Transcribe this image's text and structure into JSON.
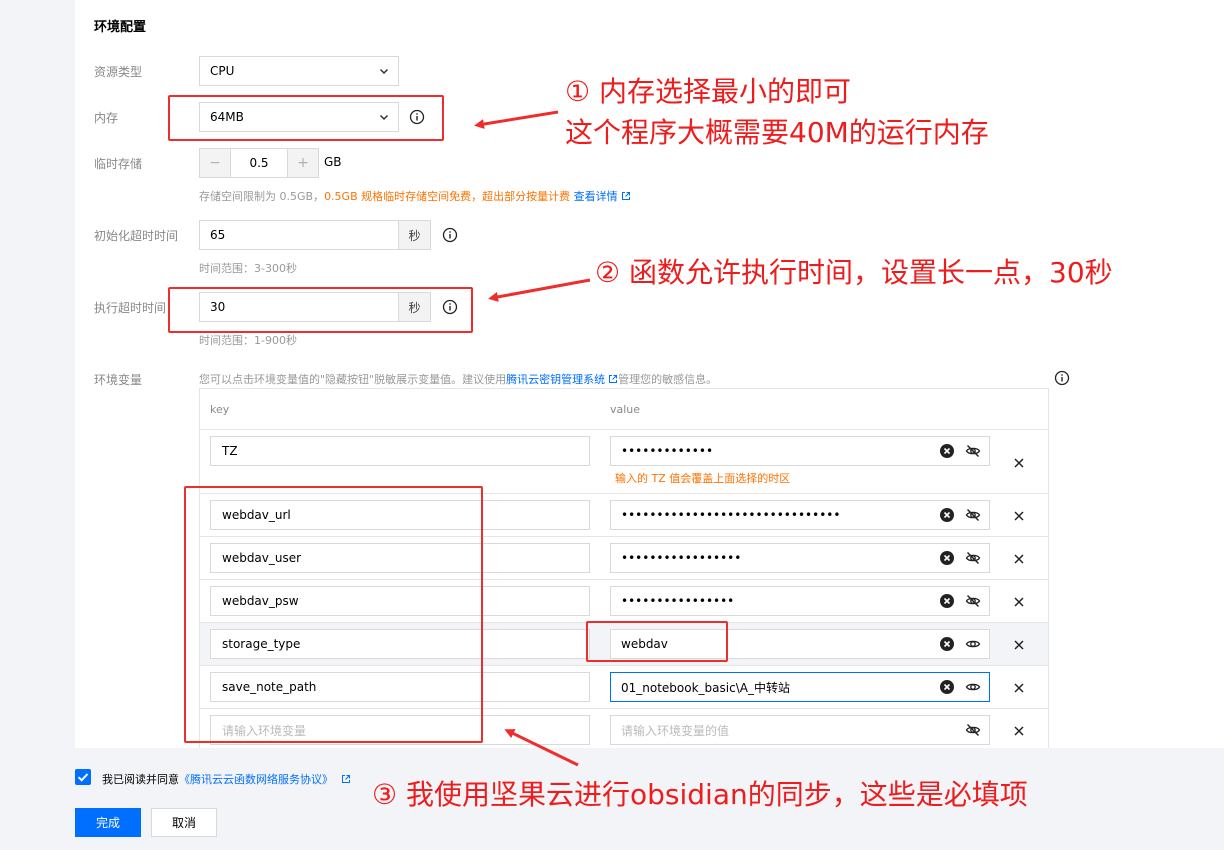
{
  "section_title": "环境配置",
  "resource": {
    "label": "资源类型",
    "value": "CPU"
  },
  "memory": {
    "label": "内存",
    "value": "64MB"
  },
  "temp_storage": {
    "label": "临时存储",
    "minus": "−",
    "value": "0.5",
    "plus": "+",
    "unit": "GB",
    "hint_prefix": "存储空间限制为 0.5GB，",
    "hint_orange": "0.5GB 规格临时存储空间免费，超出部分按量计费",
    "hint_link": "查看详情"
  },
  "init_timeout": {
    "label": "初始化超时时间",
    "value": "65",
    "unit": "秒",
    "hint": "时间范围：3-300秒"
  },
  "exec_timeout": {
    "label": "执行超时时间",
    "value": "30",
    "unit": "秒",
    "hint": "时间范围：1-900秒"
  },
  "env": {
    "label": "环境变量",
    "desc_prefix": "您可以点击环境变量值的\"隐藏按钮\"脱敏展示变量值。建议使用",
    "desc_link": "腾讯云密钥管理系统",
    "desc_suffix": "管理您的敏感信息。",
    "col_key": "key",
    "col_value": "value",
    "rows": [
      {
        "key": "TZ",
        "value": "•••••••••••••"
      },
      {
        "key": "webdav_url",
        "value": "•••••••••••••••••••••••••••••••"
      },
      {
        "key": "webdav_user",
        "value": "•••••••••••••••••"
      },
      {
        "key": "webdav_psw",
        "value": "••••••••••••••••"
      },
      {
        "key": "storage_type",
        "value": "webdav"
      },
      {
        "key": "save_note_path",
        "value": "01_notebook_basic\\A_中转站"
      }
    ],
    "tz_warning": "输入的 TZ 值会覆盖上面选择的时区",
    "new_key_placeholder": "请输入环境变量",
    "new_value_placeholder": "请输入环境变量的值"
  },
  "annotations": {
    "a1_line1": "① 内存选择最小的即可",
    "a1_line2": "这个程序大概需要40M的运行内存",
    "a2": "② 函数允许执行时间，设置长一点，30秒",
    "a3": "③ 我使用坚果云进行obsidian的同步，这些是必填项"
  },
  "footer": {
    "agree_prefix": "我已阅读并同意",
    "agree_link": "《腾讯云云函数网络服务协议》",
    "done": "完成",
    "cancel": "取消"
  },
  "colors": {
    "accent": "#006eff",
    "warning": "#ff7200",
    "annotation": "#ee1c1c"
  }
}
